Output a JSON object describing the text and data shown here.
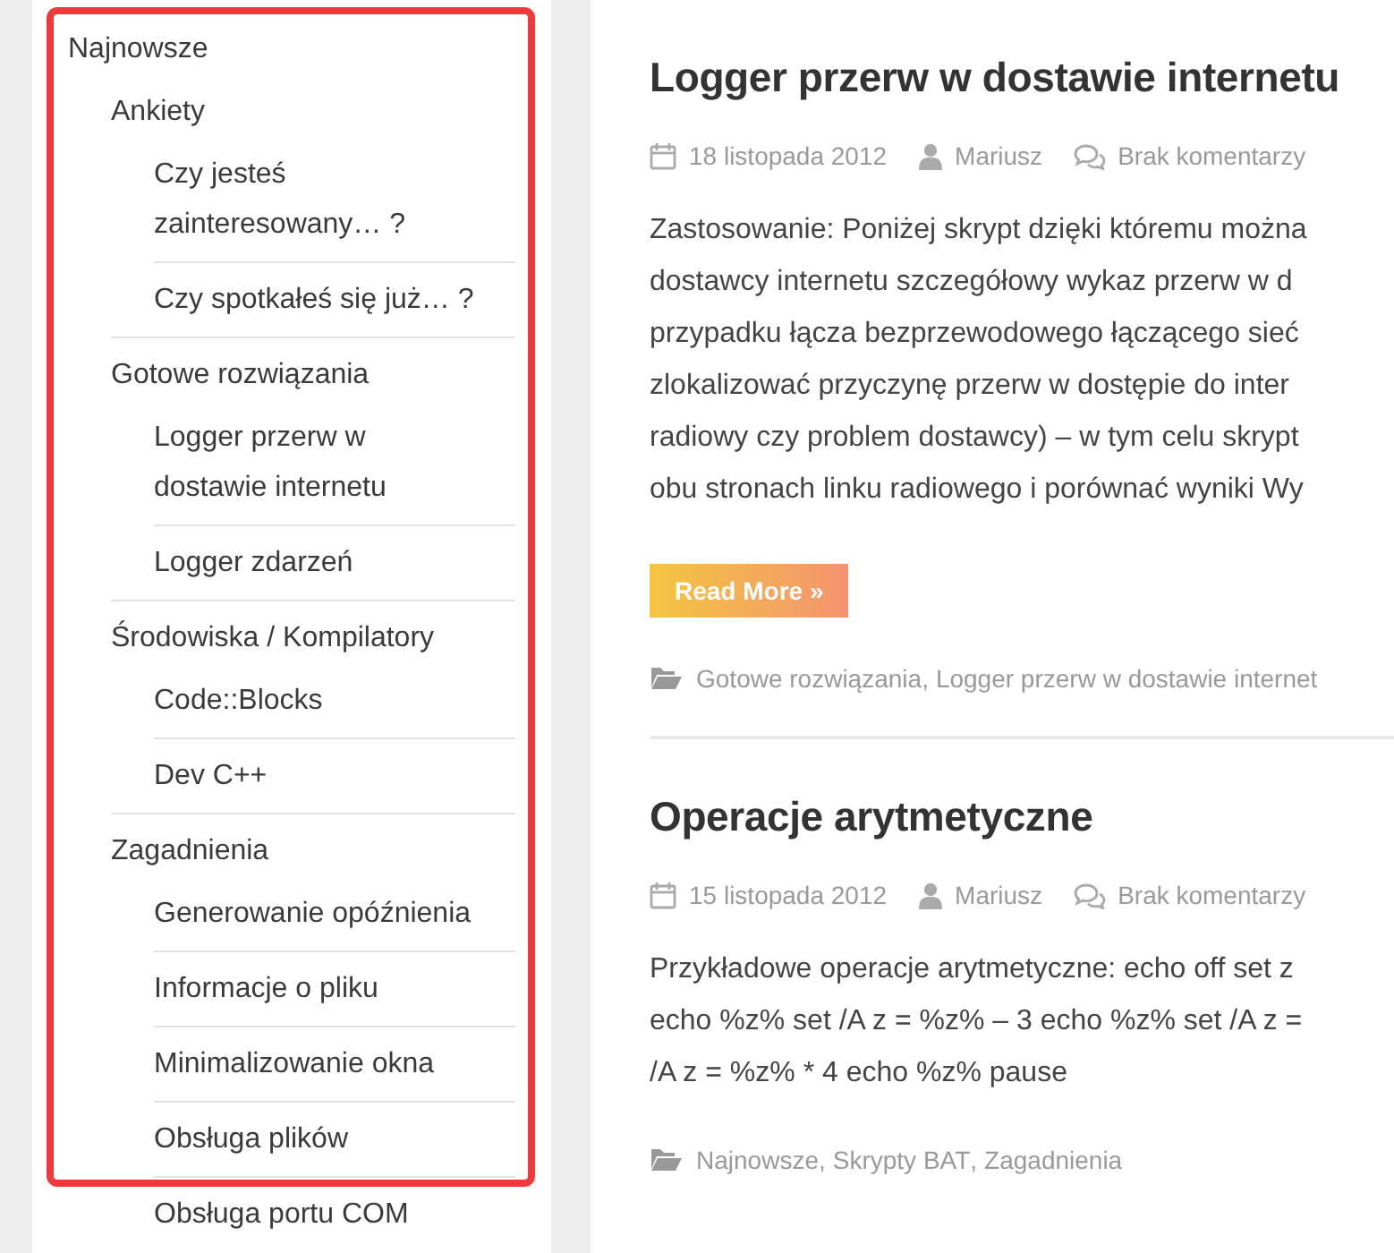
{
  "sidebar": {
    "items": [
      {
        "label": "Najnowsze",
        "children": [
          {
            "label": "Ankiety",
            "children": [
              {
                "label": "Czy jesteś zainteresowany… ?"
              },
              {
                "label": "Czy spotkałeś się już… ?"
              }
            ]
          },
          {
            "label": "Gotowe rozwiązania",
            "children": [
              {
                "label": "Logger przerw w dostawie internetu"
              },
              {
                "label": "Logger zdarzeń"
              }
            ]
          },
          {
            "label": "Środowiska / Kompilatory",
            "children": [
              {
                "label": "Code::Blocks"
              },
              {
                "label": "Dev C++"
              }
            ]
          },
          {
            "label": "Zagadnienia",
            "children": [
              {
                "label": "Generowanie opóźnienia"
              },
              {
                "label": "Informacje o pliku"
              },
              {
                "label": "Minimalizowanie okna"
              },
              {
                "label": "Obsługa plików"
              },
              {
                "label": "Obsługa portu COM"
              }
            ]
          }
        ]
      }
    ]
  },
  "category_separator": ",",
  "posts": [
    {
      "title": "Logger przerw w dostawie internetu",
      "date": "18 listopada 2012",
      "author": "Mariusz",
      "comments": "Brak komentarzy",
      "excerpt_lines": [
        "Zastosowanie: Poniżej skrypt dzięki któremu można",
        "dostawcy internetu szczegółowy wykaz przerw w d",
        "przypadku łącza bezprzewodowego łączącego sieć",
        "zlokalizować przyczynę przerw w dostępie do inter",
        "radiowy czy problem dostawcy) – w tym celu skrypt",
        "obu stronach linku radiowego i porównać wyniki Wy"
      ],
      "read_more": "Read More »",
      "categories": [
        "Gotowe rozwiązania",
        "Logger przerw w dostawie internet"
      ]
    },
    {
      "title": "Operacje arytmetyczne",
      "date": "15 listopada 2012",
      "author": "Mariusz",
      "comments": "Brak komentarzy",
      "excerpt_lines": [
        "Przykładowe operacje arytmetyczne: echo off set z",
        "echo %z% set /A z = %z% – 3 echo %z% set /A z =",
        "/A z = %z% * 4 echo %z% pause"
      ],
      "categories": [
        "Najnowsze",
        "Skrypty BAT",
        "Zagadnienia"
      ]
    }
  ]
}
